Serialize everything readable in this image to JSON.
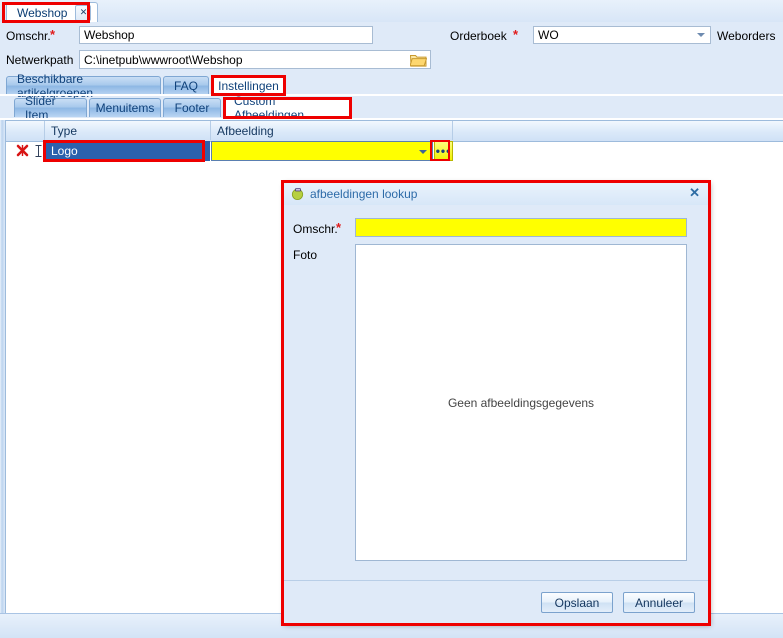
{
  "window": {
    "doc_tab_label": "Webshop",
    "doc_tab_close": "✕"
  },
  "header": {
    "omschr_label": "Omschr.",
    "omschr_required": "*",
    "omschr_value": "Webshop",
    "netwerkpath_label": "Netwerkpath",
    "netwerkpath_value": "C:\\inetpub\\wwwroot\\Webshop",
    "browse_icon": "folder-icon",
    "orderboek_label": "Orderboek",
    "orderboek_required": "*",
    "orderboek_value": "WO",
    "weborders_label": "Weborders"
  },
  "tabs_primary": [
    {
      "label": "Beschikbare artikelgroepen",
      "selected": false
    },
    {
      "label": "FAQ",
      "selected": false
    },
    {
      "label": "Instellingen",
      "selected": true
    }
  ],
  "tabs_secondary": [
    {
      "label": "Slider Item",
      "selected": false
    },
    {
      "label": "Menuitems",
      "selected": false
    },
    {
      "label": "Footer",
      "selected": false
    },
    {
      "label": "Custom Afbeeldingen",
      "selected": true
    }
  ],
  "grid": {
    "columns": [
      "Type",
      "Afbeelding"
    ],
    "rows": [
      {
        "delete_icon": "delete-row-icon",
        "edit_icon": "edit-row-icon",
        "type": "Logo",
        "afbeelding": "",
        "ellipsis_label": "•••"
      }
    ]
  },
  "dialog": {
    "title": "afbeeldingen lookup",
    "icon": "image-lookup-icon",
    "close_label": "✕",
    "omschr_label": "Omschr.",
    "omschr_required": "*",
    "omschr_value": "",
    "foto_label": "Foto",
    "foto_empty_text": "Geen afbeeldingsgegevens",
    "save_label": "Opslaan",
    "cancel_label": "Annuleer"
  },
  "colors": {
    "accent": "#2b61ad",
    "highlight_yellow": "#ffff00",
    "annotation_red": "#ee0000",
    "required_red": "#e01b1b",
    "panel_blue": "#dfeaf8"
  },
  "annotations": [
    {
      "name": "annotation-doc-tab"
    },
    {
      "name": "annotation-instellingen-tab"
    },
    {
      "name": "annotation-custom-afbeeldingen-tab"
    },
    {
      "name": "annotation-grid-type-cell"
    },
    {
      "name": "annotation-ellipsis-button"
    },
    {
      "name": "annotation-dialog"
    }
  ]
}
